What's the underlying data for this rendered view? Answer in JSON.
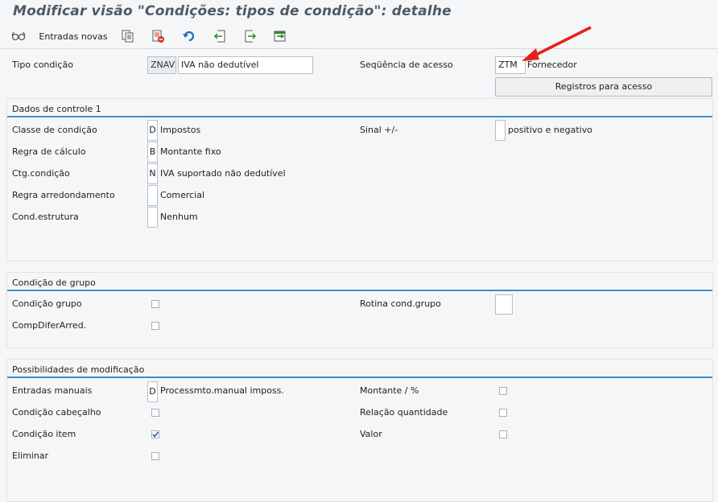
{
  "window": {
    "title": "Modificar visão \"Condições: tipos de condição\": detalhe"
  },
  "toolbar": {
    "new_entries_label": "Entradas novas"
  },
  "header": {
    "tipo_condicao_label": "Tipo condição",
    "tipo_condicao_code": "ZNAV",
    "tipo_condicao_desc": "IVA não dedutível",
    "sequencia_label": "Seqüência de acesso",
    "sequencia_code": "ZTM",
    "sequencia_desc": "Fornecedor",
    "registros_button": "Registros para acesso"
  },
  "controle": {
    "title": "Dados de controle 1",
    "classe_label": "Classe de condição",
    "classe_code": "D",
    "classe_desc": "Impostos",
    "regra_calc_label": "Regra de cálculo",
    "regra_calc_code": "B",
    "regra_calc_desc": "Montante fixo",
    "ctg_label": "Ctg.condição",
    "ctg_code": "N",
    "ctg_desc": "IVA suportado não dedutível",
    "arred_label": "Regra arredondamento",
    "arred_code": "",
    "arred_desc": "Comercial",
    "estrutura_label": "Cond.estrutura",
    "estrutura_code": "",
    "estrutura_desc": "Nenhum",
    "sinal_label": "Sinal +/-",
    "sinal_code": "",
    "sinal_desc": "positivo e negativo"
  },
  "grupo": {
    "title": "Condição de grupo",
    "condicao_grupo_label": "Condição grupo",
    "condicao_grupo_checked": false,
    "compdifer_label": "CompDiferArred.",
    "compdifer_checked": false,
    "rotina_label": "Rotina cond.grupo",
    "rotina_value": ""
  },
  "modificacao": {
    "title": "Possibilidades de modificação",
    "entradas_label": "Entradas manuais",
    "entradas_code": "D",
    "entradas_desc": "Processmto.manual imposs.",
    "cabecalho_label": "Condição cabeçalho",
    "cabecalho_checked": false,
    "item_label": "Condição item",
    "item_checked": true,
    "eliminar_label": "Eliminar",
    "eliminar_checked": false,
    "montante_label": "Montante / %",
    "montante_checked": false,
    "relacao_label": "Relação quantidade",
    "relacao_checked": false,
    "valor_label": "Valor",
    "valor_checked": false
  },
  "colors": {
    "accent": "#3a8fd0",
    "arrow": "#e8201c",
    "panel_border": "#dfe3e6"
  }
}
